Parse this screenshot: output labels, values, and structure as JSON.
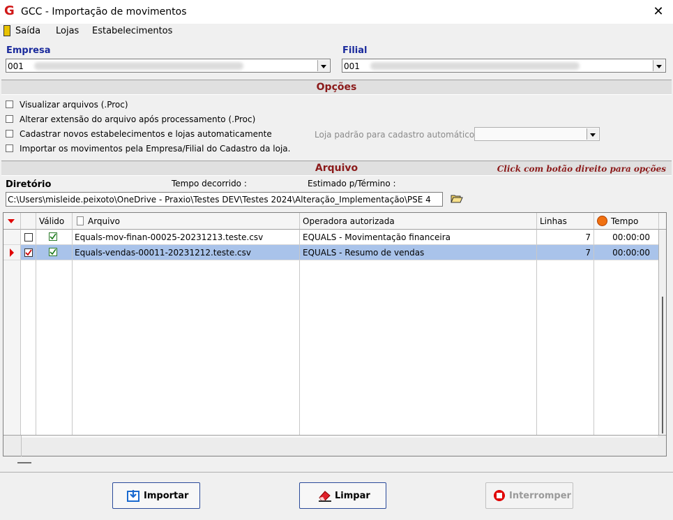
{
  "window": {
    "title": "GCC - Importação de movimentos",
    "close": "✕",
    "logo": "G"
  },
  "menu": {
    "items": [
      {
        "label": "Saída"
      },
      {
        "label": "Lojas"
      },
      {
        "label": "Estabelecimentos"
      }
    ]
  },
  "empresa": {
    "label": "Empresa",
    "value": "001"
  },
  "filial": {
    "label": "Filial",
    "value": "001"
  },
  "opcoes": {
    "title": "Opções",
    "options": [
      {
        "label": "Visualizar arquivos (.Proc)",
        "checked": false
      },
      {
        "label": "Alterar extensão do arquivo após processamento (.Proc)",
        "checked": false
      },
      {
        "label": "Cadastrar novos estabelecimentos e lojas automaticamente",
        "checked": false
      },
      {
        "label": "Importar os movimentos pela Empresa/Filial do Cadastro da loja.",
        "checked": false
      }
    ],
    "loja_padrao_label": "Loja padrão para cadastro automático"
  },
  "arquivo": {
    "title": "Arquivo",
    "hint": "Click com botão direito para opções",
    "diretorio_label": "Diretório",
    "tempo_label": "Tempo decorrido :",
    "estimado_label": "Estimado p/Término :",
    "diretorio_value": "C:\\Users\\misleide.peixoto\\OneDrive - Praxio\\Testes DEV\\Testes 2024\\Alteração_Implementação\\PSE 4"
  },
  "grid": {
    "columns": {
      "valido": "Válido",
      "arquivo": "Arquivo",
      "operadora": "Operadora autorizada",
      "linhas": "Linhas",
      "tempo": "Tempo"
    },
    "rows": [
      {
        "arquivo": "Equals-mov-finan-00025-20231213.teste.csv",
        "operadora": "EQUALS - Movimentação financeira",
        "linhas": "7",
        "tempo": "00:00:00",
        "selected": false,
        "valido": true
      },
      {
        "arquivo": "Equals-vendas-00011-20231212.teste.csv",
        "operadora": "EQUALS - Resumo de vendas",
        "linhas": "7",
        "tempo": "00:00:00",
        "selected": true,
        "valido": true
      }
    ]
  },
  "buttons": {
    "importar": "Importar",
    "limpar": "Limpar",
    "interromper": "Interromper"
  },
  "colors": {
    "accent_blue": "#1a2a9c",
    "section_red": "#8b1a1a",
    "selected_row": "#a9c3ea"
  }
}
